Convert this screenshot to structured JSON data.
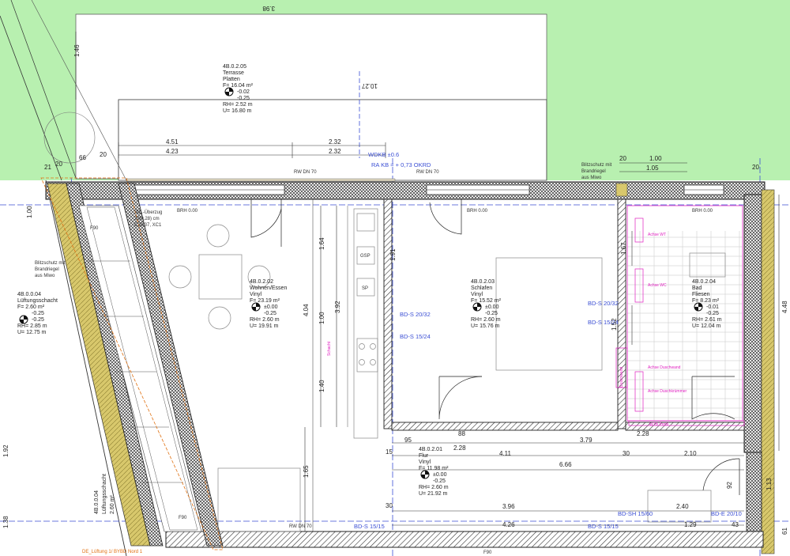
{
  "rooms": [
    {
      "id": "terrace",
      "code": "4B.0.2.05",
      "name": "Terrasse",
      "floor": "Platten",
      "area": "F= 16.04 m²",
      "level1": "-0.02",
      "level2": "-0.25",
      "rh": "RH= 2.52 m",
      "u": "U= 16.80 m"
    },
    {
      "id": "living",
      "code": "4B.0.2.02",
      "name": "Wohnen/Essen",
      "floor": "Vinyl",
      "area": "F= 23.19 m²",
      "level1": "±0.00",
      "level2": "-0.25",
      "rh": "RH= 2.60 m",
      "u": "U= 19.91 m"
    },
    {
      "id": "bedroom",
      "code": "4B.0.2.03",
      "name": "Schlafen",
      "floor": "Vinyl",
      "area": "F= 15.52 m²",
      "level1": "±0.00",
      "level2": "-0.25",
      "rh": "RH= 2.60 m",
      "u": "U= 15.76 m"
    },
    {
      "id": "bath",
      "code": "4B.0.2.04",
      "name": "Bad",
      "floor": "Fliesen",
      "area": "F= 8.23 m²",
      "level1": "-0.01",
      "level2": "-0.25",
      "rh": "RH= 2.61 m",
      "u": "U= 12.04 m"
    },
    {
      "id": "hall",
      "code": "4B.0.2.01",
      "name": "Flur",
      "floor": "Vinyl",
      "area": "F= 11.98 m²",
      "level1": "±0.00",
      "level2": "-0.25",
      "rh": "RH= 2.60 m",
      "u": "U= 21.92 m"
    },
    {
      "id": "shaft",
      "code": "4B.0.0.04",
      "name": "Lüftungsschacht",
      "area": "F= 2.60 m²",
      "level1": "-0.25",
      "level2": "-0.25",
      "rh": "RH= 2.85 m",
      "u": "U= 12.75 m"
    }
  ],
  "shaft_vertical": {
    "code": "4B.0.0.04",
    "name": "Lüftungsschacht",
    "area": "2.60 m²"
  },
  "labels": {
    "wdkb": "WDKB ±0.6",
    "rakb": "RA KB = + 0,73 OKRD",
    "rw_left": "RW DN 70",
    "rw_right": "RW DN 70",
    "rw_bottom": "RW DN 70",
    "blitz_top_1": "Blitzschutz mit",
    "blitz_top_2": "Brandriegel",
    "blitz_top_3": "aus Miwo",
    "blitz_left_1": "Blitzschutz mit",
    "blitz_left_2": "Brandriegel",
    "blitz_left_3": "aus Miwo",
    "stb_1": "Stb.-Überzug",
    "stb_2": "20/0,28) cm",
    "stb_3": "C30/37, XC1",
    "brh1": "BRH 0.00",
    "brh2": "BRH 0.00",
    "brh3": "BRH 0.00",
    "gsp": "GSP",
    "sp": "SP",
    "f90_1": "F90",
    "f90_2": "F90",
    "f90_3": "F90",
    "bds2032_l": "BD-S 20/32",
    "bds1524_l": "BD-S 15/24",
    "bds2032_r": "BD-S 20/32",
    "bds1524_r": "BD-S 15/24",
    "bds1515_l": "BD-S 15/15",
    "bds1515_r": "BD-S 15/15",
    "bdsh": "BD-SH 15/60",
    "bde": "BD-E 20/10",
    "bottom_note": "DE_Lüftung 1/ BYBD Nord 1",
    "mag1": "Achse WT",
    "mag2": "Achse WC",
    "mag3": "Achse Duschwand",
    "mag4": "Achse Duschkrümmer",
    "mag5": "WTB Profil",
    "duschwand": "Duschwand",
    "schacht": "Schacht"
  },
  "dims": {
    "d146": "1.46",
    "d1027": "10.27",
    "d398": "3.98",
    "d451": "4.51",
    "d423": "4.23",
    "d232a": "2.32",
    "d232b": "2.32",
    "d100a": "1.00",
    "d105": "1.05",
    "d20a": "20",
    "d20b": "20",
    "d20c": "20",
    "d66": "66",
    "d21": "21",
    "d20d": "20",
    "d164": "1.64",
    "d404": "4.04",
    "d392": "3.92",
    "d100b": "1.00",
    "d140": "1.40",
    "d165": "1.65",
    "d191": "1.91",
    "d152": "1.52",
    "d167": "1.67",
    "d95": "95",
    "d88a": "88",
    "d228a": "2.28",
    "d379": "3.79",
    "d15a": "15",
    "d411": "4.11",
    "d666": "6.66",
    "d228b": "2.28",
    "d30a": "30",
    "d210": "2.10",
    "d396": "3.96",
    "d240": "2.40",
    "d426": "4.26",
    "d129": "1.29",
    "d43": "43",
    "d30b": "30",
    "d448": "4.48",
    "d113": "1.13",
    "d92": "92",
    "d61": "61",
    "d192": "1.92",
    "d138": "1.38",
    "d100c": "1.00"
  },
  "colors": {
    "green": "#b8f0b0",
    "blue": "#3b4fd4",
    "magenta": "#e020c0",
    "orange": "#e07010",
    "insulation": "#d8c86c"
  }
}
